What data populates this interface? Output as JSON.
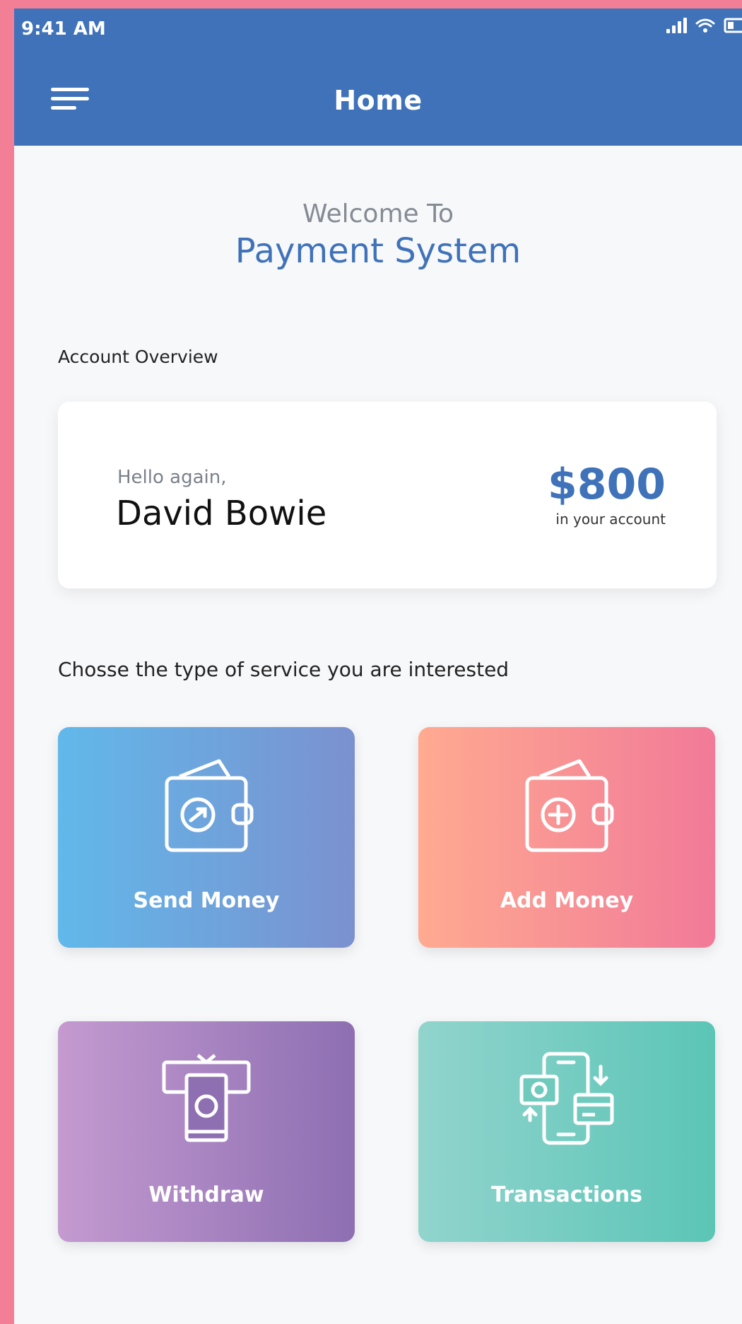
{
  "status_bar": {
    "time": "9:41 AM",
    "signal_icon": "signal-icon",
    "wifi_icon": "wifi-icon",
    "battery_icon": "battery-icon"
  },
  "header": {
    "title": "Home",
    "menu_icon": "menu-icon"
  },
  "welcome": {
    "line1": "Welcome To",
    "line2": "Payment System"
  },
  "account_overview": {
    "label": "Account Overview",
    "greeting": "Hello again,",
    "user_name": "David Bowie",
    "balance": "$800",
    "balance_caption": "in your account"
  },
  "services": {
    "prompt": "Chosse the type of service you are interested",
    "items": [
      {
        "label": "Send Money",
        "icon": "wallet-send-icon"
      },
      {
        "label": "Add Money",
        "icon": "wallet-add-icon"
      },
      {
        "label": "Withdraw",
        "icon": "atm-withdraw-icon"
      },
      {
        "label": "Transactions",
        "icon": "phone-transactions-icon"
      }
    ]
  },
  "colors": {
    "primary": "#3f72b9",
    "page_border": "#f27f95",
    "background": "#f7f8fa",
    "send_money_gradient": [
      "#61b8ea",
      "#7b91cf"
    ],
    "add_money_gradient": [
      "#ffaa91",
      "#f17a98"
    ],
    "withdraw_gradient": [
      "#c49ad0",
      "#8d6fb2"
    ],
    "transactions_gradient": [
      "#91d4cd",
      "#5bc5b6"
    ]
  }
}
